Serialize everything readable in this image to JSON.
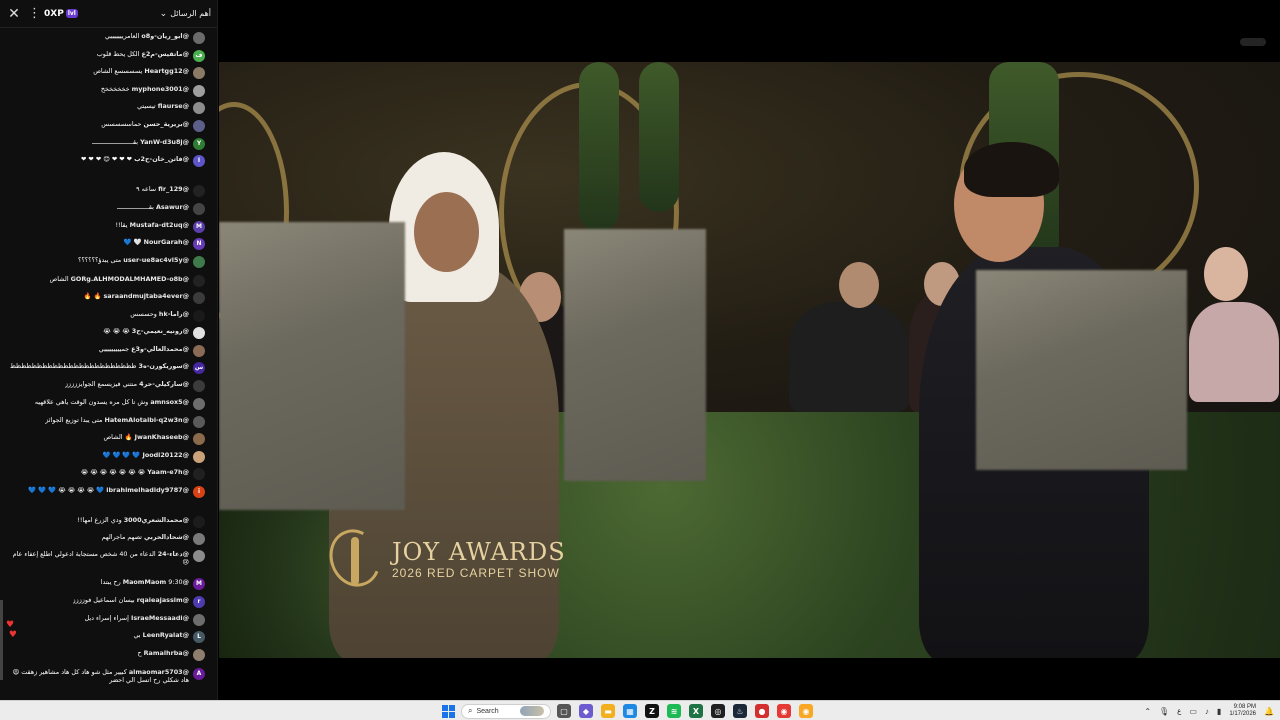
{
  "chat": {
    "header": {
      "title": "أهم الرسائل",
      "xp_label": "0XP",
      "xp_badge": "lvl"
    },
    "messages": [
      {
        "author": "@ابو_ريان-وo8",
        "text": "العامريييييييي",
        "avatar_color": "#6b6b6b",
        "avatar_text": ""
      },
      {
        "author": "@ماتقيس-م2ع",
        "text": "الكل يحط قلوب",
        "avatar_color": "#4caf50",
        "avatar_text": "ف"
      },
      {
        "author": "@Heartgg12",
        "text": "يسسسسع الشاص",
        "avatar_color": "#8a7a66",
        "avatar_text": ""
      },
      {
        "author": "@myphone3001",
        "text": "خخخخخخخ",
        "avatar_color": "#9e9e9e",
        "avatar_text": ""
      },
      {
        "author": "@flaurse",
        "text": "تيسيتي",
        "avatar_color": "#8d8d8d",
        "avatar_text": ""
      },
      {
        "author": "@بريرية_حسن",
        "text": "حماسسسسس",
        "avatar_color": "#5c5f8a",
        "avatar_text": ""
      },
      {
        "author": "@YanW-d3u8j",
        "text": "بقــــــــــــــــــــــ",
        "avatar_color": "#2e7d32",
        "avatar_text": "Y"
      },
      {
        "author": "@فاتن_خان-ح2ب",
        "text": "❤ ❤ ❤ 😊 ❤ ❤ ❤",
        "avatar_color": "#5e55c9",
        "avatar_text": "I",
        "multi": true
      },
      {
        "author": "@fir_129",
        "text": "ساعه ٩",
        "avatar_color": "#222222",
        "avatar_text": ""
      },
      {
        "author": "@Asawur",
        "text": "بقـــــــــــــــــ",
        "avatar_color": "#444444",
        "avatar_text": ""
      },
      {
        "author": "@Mustafa-dt2uq",
        "text": "يقا!!",
        "avatar_color": "#5b3ea8",
        "avatar_text": "M"
      },
      {
        "author": "@NourGarah",
        "text": "🤍 💙",
        "avatar_color": "#673ab7",
        "avatar_text": "N"
      },
      {
        "author": "@user-ue8ac4vl5y",
        "text": "متى يبدؤ؟؟؟؟؟؟",
        "avatar_color": "#3f7a4a",
        "avatar_text": ""
      },
      {
        "author": "@GORg.ALHMODALMHAMED-o8b",
        "text": "الشاص",
        "avatar_color": "#222222",
        "avatar_text": ""
      },
      {
        "author": "@saraandmujtaba4ever",
        "text": "🔥 🔥",
        "avatar_color": "#3b3b3b",
        "avatar_text": ""
      },
      {
        "author": "@راما-hk",
        "text": "وحسسس",
        "avatar_color": "#1a1a1a",
        "avatar_text": ""
      },
      {
        "author": "@رونيه_نعيمي-ح3",
        "text": "😭 😭 😭",
        "avatar_color": "#e0e0e0",
        "avatar_text": ""
      },
      {
        "author": "@محمدالعالي-و3ع",
        "text": "جميييييييييي",
        "avatar_color": "#8b6b55",
        "avatar_text": ""
      },
      {
        "author": "@سوريكورن-ه3",
        "text": "ظظظظظظظظظظظظظظظظظظظظظظظظ",
        "avatar_color": "#4527a0",
        "avatar_text": "س"
      },
      {
        "author": "@ساركيلي-حر4",
        "text": "منتني فيزيسمع الجوايززززز",
        "avatar_color": "#3b3b3b",
        "avatar_text": ""
      },
      {
        "author": "@amnsox5",
        "text": "وش تا كل مره يسدون الوقت ياهي علاقهيه",
        "avatar_color": "#6d6d6d",
        "avatar_text": ""
      },
      {
        "author": "@HatemAlotaibi-q2w3n",
        "text": "متى يبدا توزيع الجوائز",
        "avatar_color": "#5a5a5a",
        "avatar_text": ""
      },
      {
        "author": "@JwanKhaseeb",
        "text": "🔥 الشاص",
        "avatar_color": "#8a6a4a",
        "avatar_text": ""
      },
      {
        "author": "@Joodi20122",
        "text": "💙 💙 💙 💙",
        "avatar_color": "#c9a27a",
        "avatar_text": ""
      },
      {
        "author": "@Yaam-e7h",
        "text": "😭 😭 😭 😭 😭 😭 😭",
        "avatar_color": "#202020",
        "avatar_text": ""
      },
      {
        "author": "@ibrahimelhadidy9787",
        "text": "💙 😭 😭 😭 😭 💙 💙 💙",
        "avatar_color": "#d84315",
        "avatar_text": "i",
        "multi": true
      },
      {
        "author": "@محمدالشعري3000",
        "text": "ودي الزرع امها!!",
        "avatar_color": "#1c1c1c",
        "avatar_text": ""
      },
      {
        "author": "@شحادالحربي",
        "text": "تصهم ماجرالهم",
        "avatar_color": "#7a7a7a",
        "avatar_text": ""
      },
      {
        "author": "@دعاء-24",
        "text": "الدعاء من 40 شخص مستجابة ادعولي اطلع إعفاء عام 😢",
        "avatar_color": "#8c8c8c",
        "avatar_text": "",
        "multi": true
      },
      {
        "author": "@MaomMaom",
        "text": "9:30 رح يبتدا",
        "avatar_color": "#6a1b9a",
        "avatar_text": "M"
      },
      {
        "author": "@rqaieajassim",
        "text": "بيسان اسماعيل فوزززز",
        "avatar_color": "#4e3bb0",
        "avatar_text": "r"
      },
      {
        "author": "@IsraeMessaadi",
        "text": "إسراء إسراء ديل",
        "avatar_color": "#6d6d6d",
        "avatar_text": ""
      },
      {
        "author": "@LeenRyalat",
        "text": "بي",
        "avatar_color": "#455a64",
        "avatar_text": "L"
      },
      {
        "author": "@Ramalhrba",
        "text": "ح",
        "avatar_color": "#8e7e6e",
        "avatar_text": ""
      },
      {
        "author": "@almaomar5703",
        "text": "كبيير مثل شو هاد كل هاد مشاهير زهقت 😩 هاد شكلي رح اتسل الي احضر",
        "avatar_color": "#6a1b9a",
        "avatar_text": "A",
        "multi": true
      }
    ]
  },
  "video": {
    "logo_title": "JOY AWARDS",
    "logo_subtitle": "2026 RED CARPET SHOW"
  },
  "taskbar": {
    "search_placeholder": "Search",
    "apps": [
      {
        "name": "task-view",
        "color": "#555555",
        "glyph": "▢"
      },
      {
        "name": "copilot",
        "color": "#6d5bd0",
        "glyph": "◆"
      },
      {
        "name": "file-explorer",
        "color": "#f2b01e",
        "glyph": "▬"
      },
      {
        "name": "store",
        "color": "#1e88e5",
        "glyph": "▦"
      },
      {
        "name": "notion",
        "color": "#111111",
        "glyph": "Z"
      },
      {
        "name": "spotify",
        "color": "#1db954",
        "glyph": "≋"
      },
      {
        "name": "excel",
        "color": "#1f7244",
        "glyph": "X"
      },
      {
        "name": "obs",
        "color": "#202020",
        "glyph": "◎"
      },
      {
        "name": "steam",
        "color": "#1b2838",
        "glyph": "♨"
      },
      {
        "name": "recorder",
        "color": "#d32f2f",
        "glyph": "●"
      },
      {
        "name": "chrome",
        "color": "#e53935",
        "glyph": "◉"
      },
      {
        "name": "chrome-canary",
        "color": "#f9a825",
        "glyph": "◉"
      }
    ],
    "tray": {
      "lang": "ع",
      "time": "9:08 PM",
      "date": "1/17/2026"
    }
  }
}
